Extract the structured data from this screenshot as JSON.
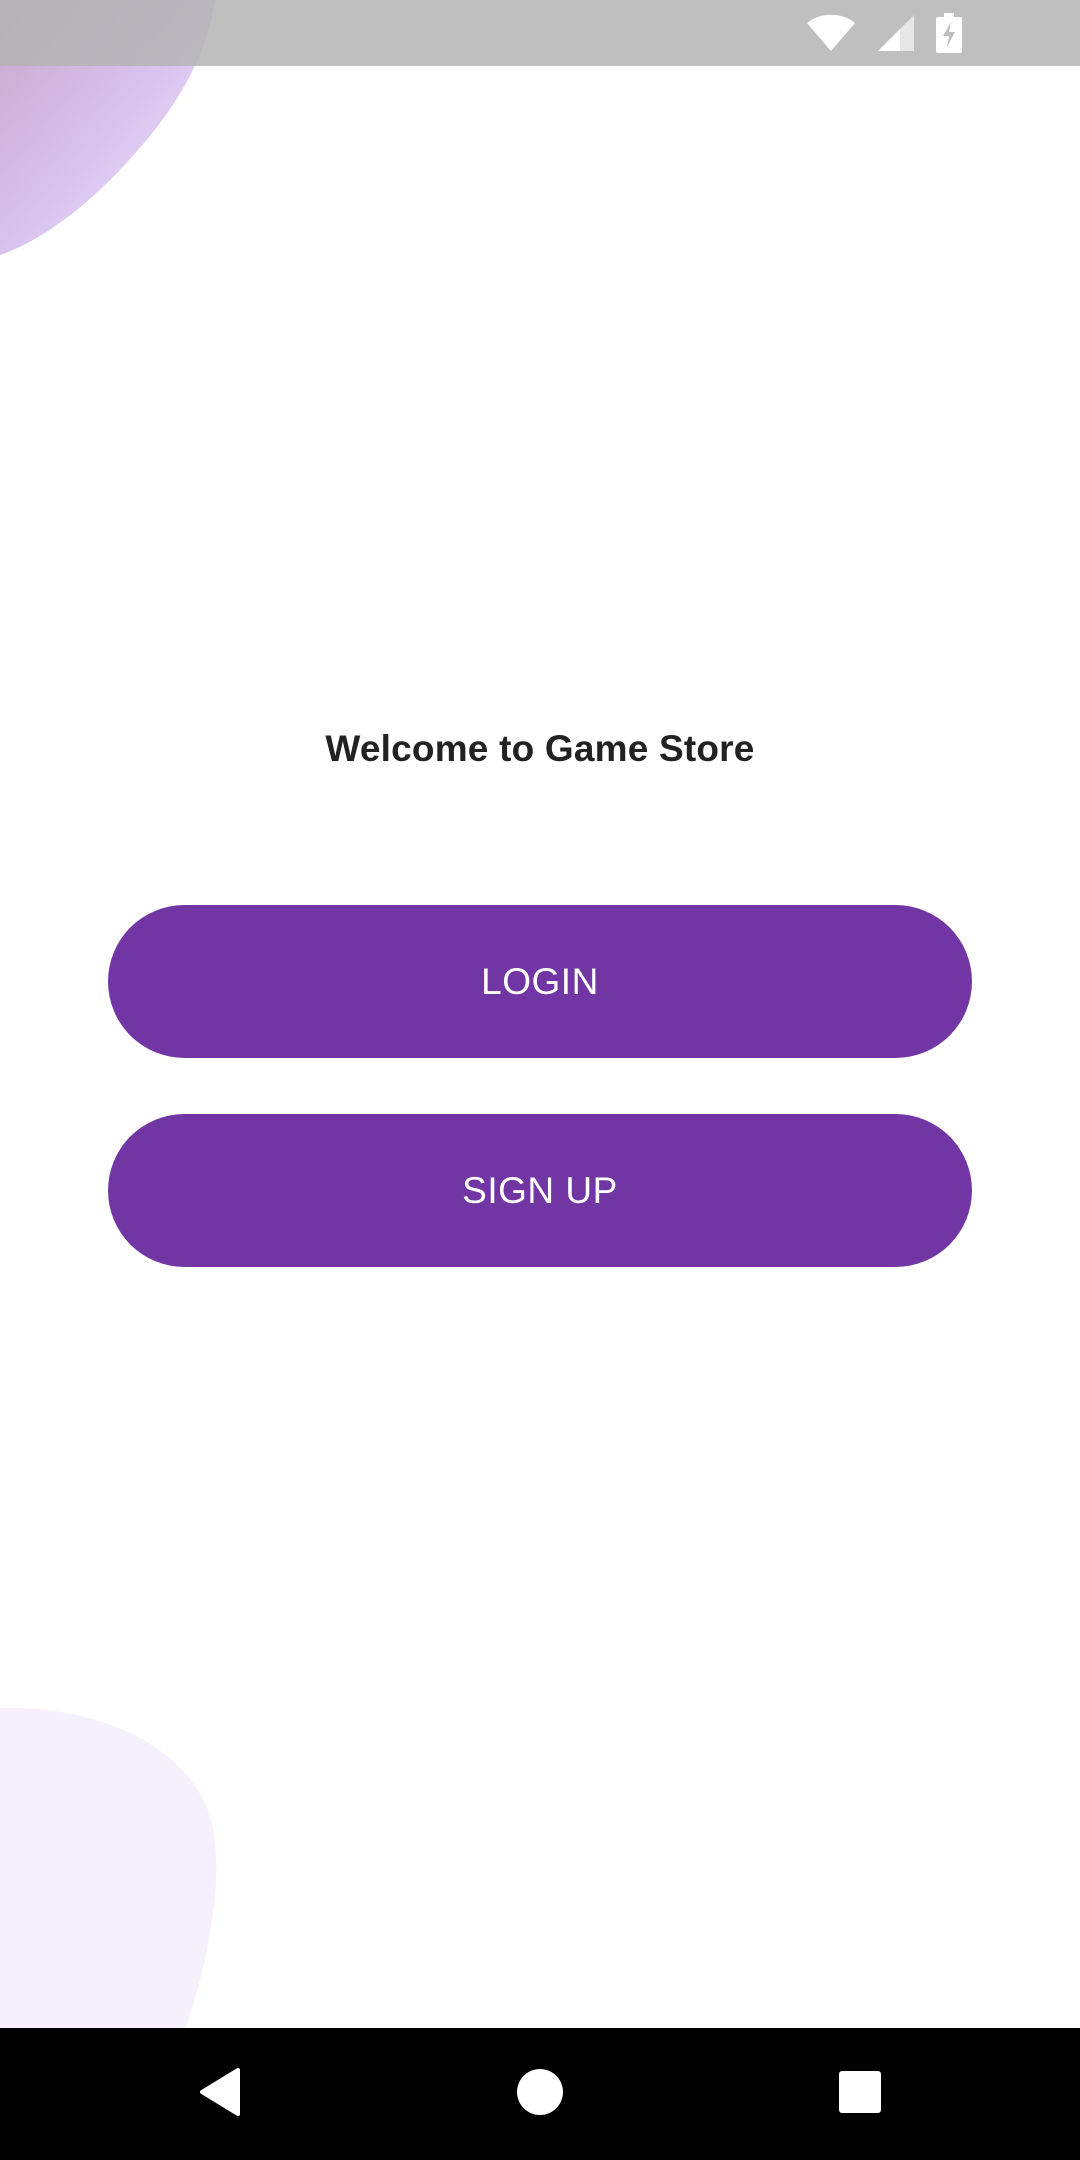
{
  "app": {
    "welcome_text": "Welcome to Game Store"
  },
  "buttons": {
    "login_label": "LOGIN",
    "signup_label": "SIGN UP"
  },
  "status_bar": {
    "icons": [
      "wifi-icon",
      "cell-signal-icon",
      "battery-charging-icon"
    ]
  },
  "nav_bar": {
    "icons": [
      "back-icon",
      "home-icon",
      "recents-icon"
    ]
  },
  "colors": {
    "accent": "#7136A4",
    "text": "#222222",
    "nav_bar": "#000000",
    "status_bar": "#BDBDBD",
    "blob_top_start": "#C9A6C9",
    "blob_top_end": "#E8E4FF",
    "blob_bottom": "#F6F0FD"
  }
}
